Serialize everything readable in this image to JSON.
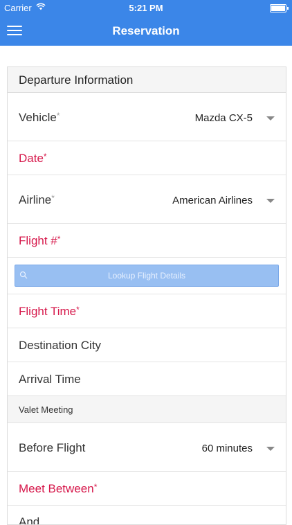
{
  "status_bar": {
    "carrier": "Carrier",
    "time": "5:21 PM"
  },
  "nav": {
    "title": "Reservation",
    "menu_icon": "hamburger-menu-icon"
  },
  "section": {
    "title": "Departure Information"
  },
  "fields": {
    "vehicle": {
      "label": "Vehicle",
      "required": "*",
      "value": "Mazda CX-5"
    },
    "date": {
      "label": "Date",
      "required": "*"
    },
    "airline": {
      "label": "Airline",
      "required": "*",
      "value": "American Airlines"
    },
    "flight_number": {
      "label": "Flight #",
      "required": "*"
    },
    "lookup_button": {
      "label": "Lookup Flight Details"
    },
    "flight_time": {
      "label": "Flight Time",
      "required": "*"
    },
    "destination_city": {
      "label": "Destination City"
    },
    "arrival_time": {
      "label": "Arrival Time"
    },
    "valet_meeting": {
      "label": "Valet Meeting"
    },
    "before_flight": {
      "label": "Before Flight",
      "value": "60 minutes"
    },
    "meet_between": {
      "label": "Meet Between",
      "required": "*"
    },
    "and": {
      "label": "And"
    }
  },
  "colors": {
    "header_blue": "#3b86e8",
    "required_red": "#d6174a",
    "lookup_button_blue": "#98bff2"
  }
}
